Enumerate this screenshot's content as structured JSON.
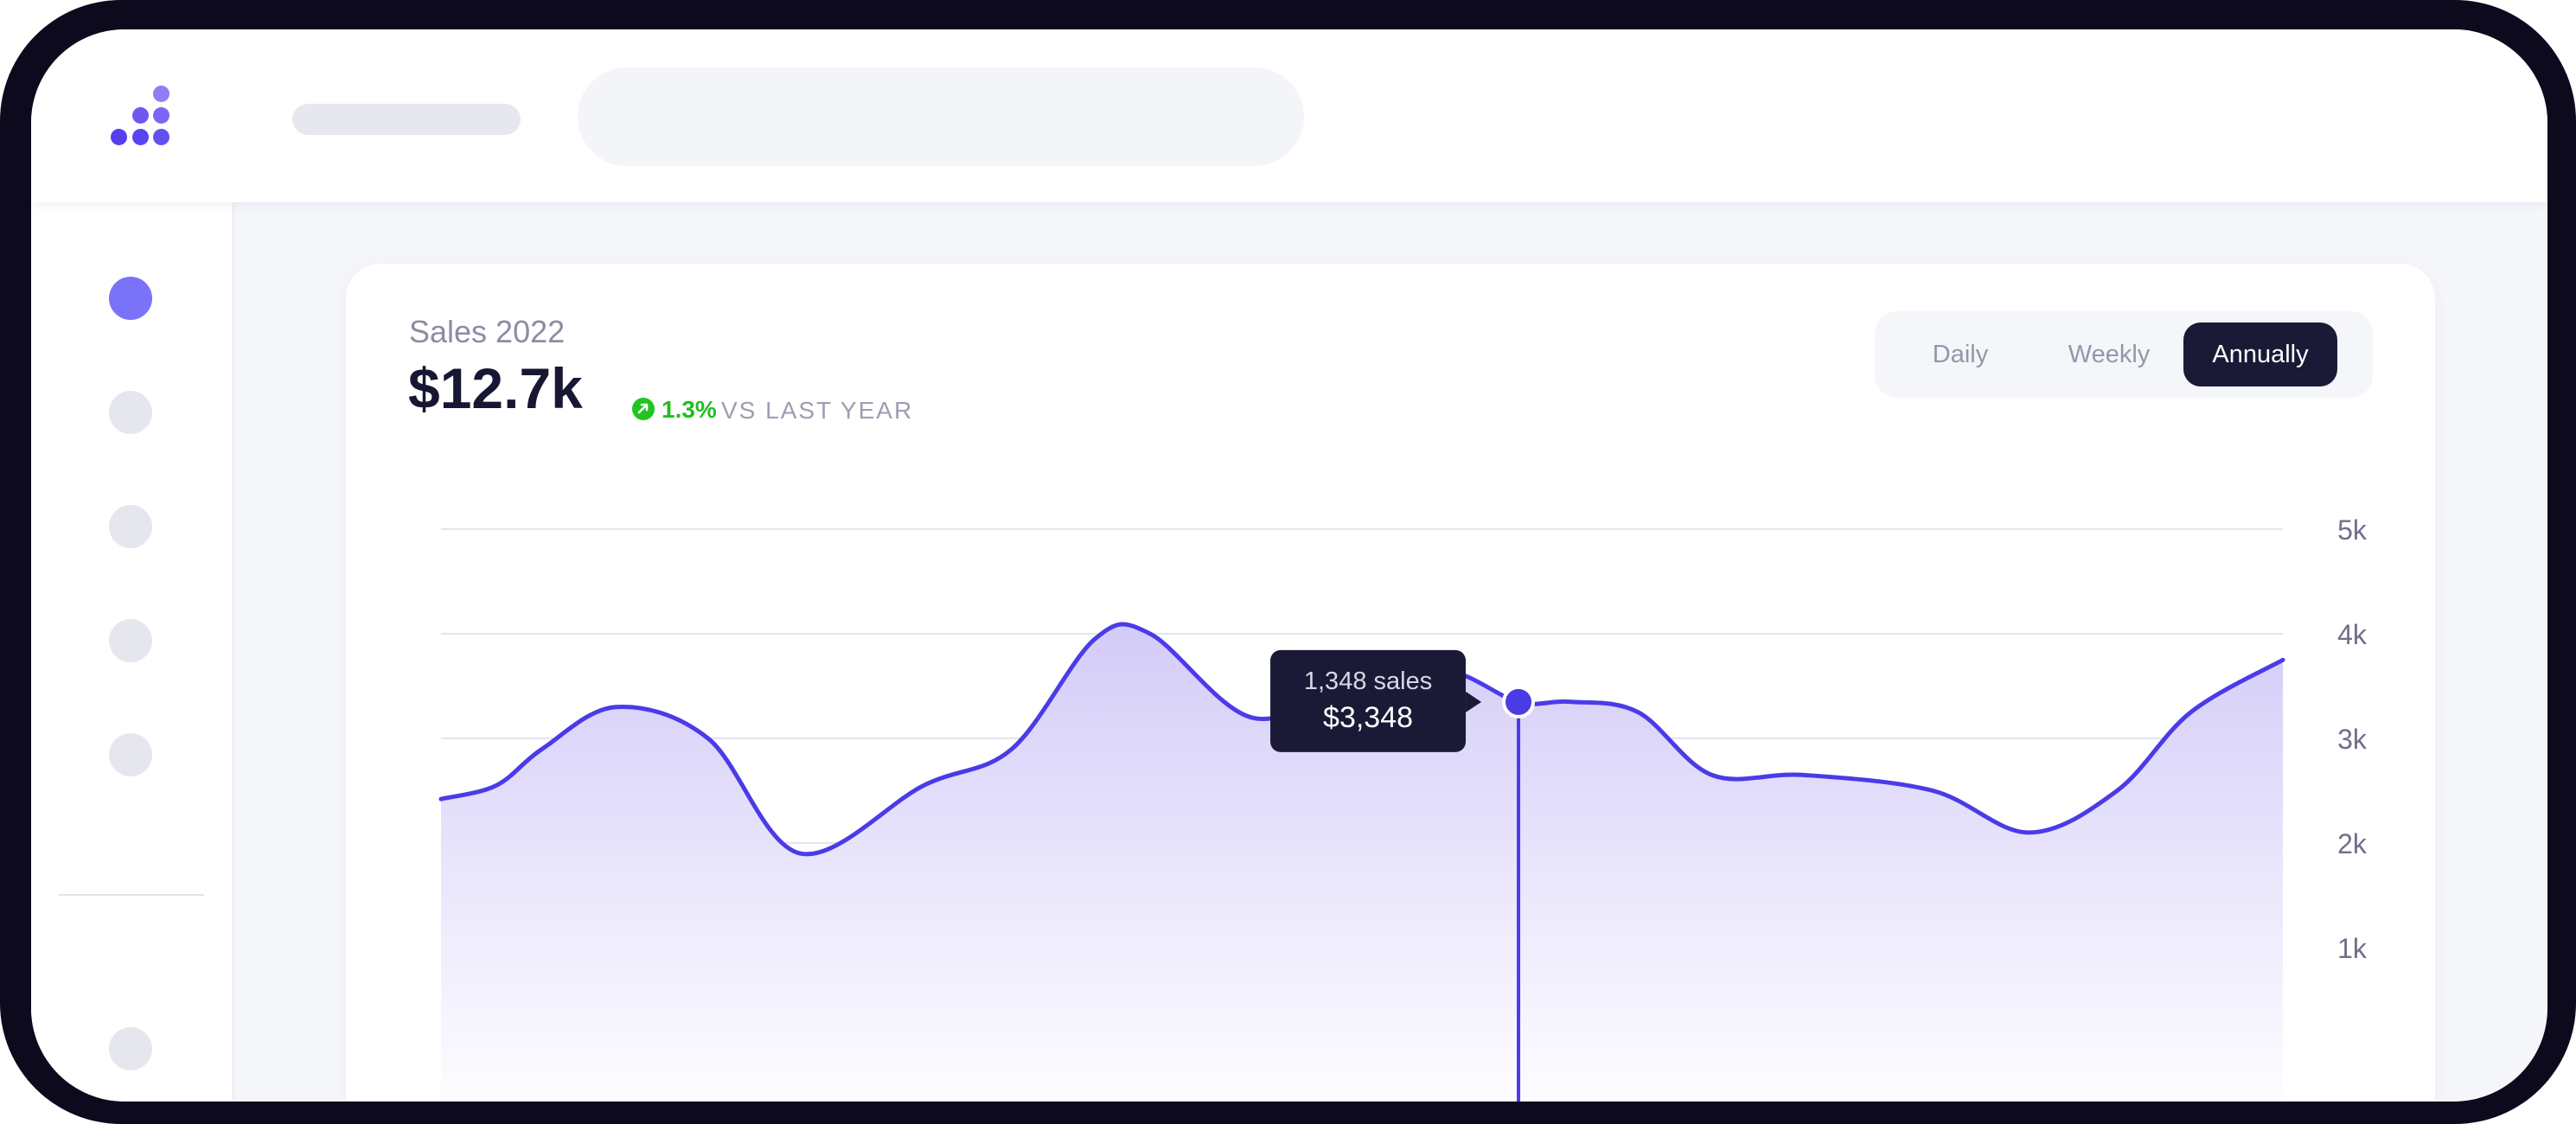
{
  "nav": {
    "items": [
      {
        "name": "nav-item-1",
        "active": true
      },
      {
        "name": "nav-item-2",
        "active": false
      },
      {
        "name": "nav-item-3",
        "active": false
      },
      {
        "name": "nav-item-4",
        "active": false
      },
      {
        "name": "nav-item-5",
        "active": false
      },
      {
        "name": "nav-item-6",
        "active": false
      }
    ]
  },
  "card": {
    "title": "Sales 2022",
    "value": "$12.7k",
    "trend": {
      "percent": "1.3%",
      "label": "VS LAST YEAR",
      "direction": "up"
    },
    "periods": [
      "Daily",
      "Weekly",
      "Annually"
    ],
    "selected_period": "Annually"
  },
  "chart_data": {
    "type": "area",
    "title": "",
    "xlabel": "",
    "ylabel": "",
    "ylim": [
      0,
      5000
    ],
    "y_ticks": [
      {
        "value": 5000,
        "label": "5k"
      },
      {
        "value": 4000,
        "label": "4k"
      },
      {
        "value": 3000,
        "label": "3k"
      },
      {
        "value": 2000,
        "label": "2k"
      },
      {
        "value": 1000,
        "label": "1k"
      }
    ],
    "grid": true,
    "series": [
      {
        "x": [
          0,
          0.03,
          0.055,
          0.095,
          0.145,
          0.195,
          0.262,
          0.31,
          0.355,
          0.385,
          0.44,
          0.495,
          0.545,
          0.585,
          0.613,
          0.65,
          0.69,
          0.74,
          0.81,
          0.862,
          0.91,
          0.95,
          1.0
        ],
        "values": [
          2420,
          2550,
          2900,
          3300,
          3000,
          1900,
          2550,
          2900,
          3950,
          4000,
          3200,
          3500,
          3650,
          3348,
          3350,
          3250,
          2650,
          2650,
          2500,
          2100,
          2500,
          3250,
          3750
        ]
      }
    ],
    "highlight": {
      "index": 13,
      "label_count": "1,348 sales",
      "label_value": "$3,348"
    },
    "colors": {
      "line": "#4b3be7",
      "fill_top": "#d4ccf8",
      "grid": "#e3e4ec",
      "tooltip_bg": "#1b1a36"
    }
  }
}
